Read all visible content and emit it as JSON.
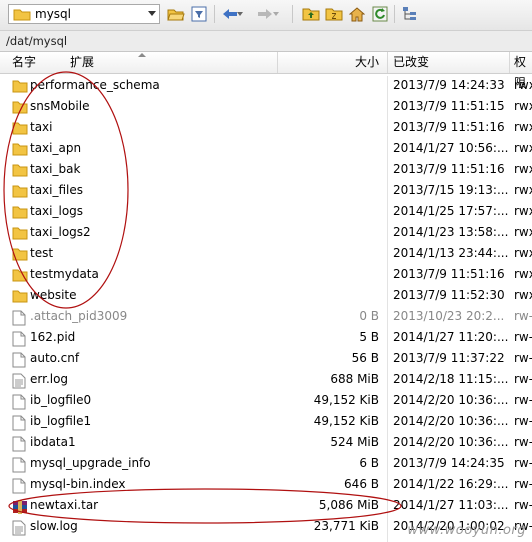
{
  "toolbar": {
    "location": "mysql"
  },
  "path": "/dat/mysql",
  "columns": {
    "name": "名字",
    "ext": "扩展",
    "size": "大小",
    "modified": "已改变",
    "perms": "权限"
  },
  "files": [
    {
      "name": "performance_schema",
      "size": "",
      "modified": "2013/7/9 14:24:33",
      "perms": "rwx",
      "icon": "folder-icon",
      "dim": false
    },
    {
      "name": "snsMobile",
      "size": "",
      "modified": "2013/7/9 11:51:15",
      "perms": "rwx",
      "icon": "folder-icon",
      "dim": false
    },
    {
      "name": "taxi",
      "size": "",
      "modified": "2013/7/9 11:51:16",
      "perms": "rwx",
      "icon": "folder-icon",
      "dim": false
    },
    {
      "name": "taxi_apn",
      "size": "",
      "modified": "2014/1/27 10:56:...",
      "perms": "rwx",
      "icon": "folder-icon",
      "dim": false
    },
    {
      "name": "taxi_bak",
      "size": "",
      "modified": "2013/7/9 11:51:16",
      "perms": "rwx",
      "icon": "folder-icon",
      "dim": false
    },
    {
      "name": "taxi_files",
      "size": "",
      "modified": "2013/7/15 19:13:...",
      "perms": "rwx",
      "icon": "folder-icon",
      "dim": false
    },
    {
      "name": "taxi_logs",
      "size": "",
      "modified": "2014/1/25 17:57:...",
      "perms": "rwx",
      "icon": "folder-icon",
      "dim": false
    },
    {
      "name": "taxi_logs2",
      "size": "",
      "modified": "2014/1/23 13:58:...",
      "perms": "rwx",
      "icon": "folder-icon",
      "dim": false
    },
    {
      "name": "test",
      "size": "",
      "modified": "2014/1/13 23:44:...",
      "perms": "rwx",
      "icon": "folder-icon",
      "dim": false
    },
    {
      "name": "testmydata",
      "size": "",
      "modified": "2013/7/9 11:51:16",
      "perms": "rwx",
      "icon": "folder-icon",
      "dim": false
    },
    {
      "name": "website",
      "size": "",
      "modified": "2013/7/9 11:52:30",
      "perms": "rwx",
      "icon": "folder-icon",
      "dim": false
    },
    {
      "name": ".attach_pid3009",
      "size": "0 B",
      "modified": "2013/10/23 20:2...",
      "perms": "rw-",
      "icon": "file-icon",
      "dim": true
    },
    {
      "name": "162.pid",
      "size": "5 B",
      "modified": "2014/1/27 11:20:...",
      "perms": "rw-",
      "icon": "file-icon",
      "dim": false
    },
    {
      "name": "auto.cnf",
      "size": "56 B",
      "modified": "2013/7/9 11:37:22",
      "perms": "rw-",
      "icon": "file-icon",
      "dim": false
    },
    {
      "name": "err.log",
      "size": "688 MiB",
      "modified": "2014/2/18 11:15:...",
      "perms": "rw-",
      "icon": "text-file-icon",
      "dim": false
    },
    {
      "name": "ib_logfile0",
      "size": "49,152 KiB",
      "modified": "2014/2/20 10:36:...",
      "perms": "rw-",
      "icon": "file-icon",
      "dim": false
    },
    {
      "name": "ib_logfile1",
      "size": "49,152 KiB",
      "modified": "2014/2/20 10:36:...",
      "perms": "rw-",
      "icon": "file-icon",
      "dim": false
    },
    {
      "name": "ibdata1",
      "size": "524 MiB",
      "modified": "2014/2/20 10:36:...",
      "perms": "rw-",
      "icon": "file-icon",
      "dim": false
    },
    {
      "name": "mysql_upgrade_info",
      "size": "6 B",
      "modified": "2013/7/9 14:24:35",
      "perms": "rw-",
      "icon": "file-icon",
      "dim": false
    },
    {
      "name": "mysql-bin.index",
      "size": "646 B",
      "modified": "2014/1/22 16:29:...",
      "perms": "rw-",
      "icon": "file-icon",
      "dim": false
    },
    {
      "name": "newtaxi.tar",
      "size": "5,086 MiB",
      "modified": "2014/1/27 11:03:...",
      "perms": "rw-",
      "icon": "archive-icon",
      "dim": false
    },
    {
      "name": "slow.log",
      "size": "23,771 KiB",
      "modified": "2014/2/20 1:00:02",
      "perms": "rw-",
      "icon": "text-file-icon",
      "dim": false
    }
  ],
  "watermark": "www.wooyun.org",
  "colors": {
    "folder": "#f2c443",
    "annotation": "#b01010"
  }
}
